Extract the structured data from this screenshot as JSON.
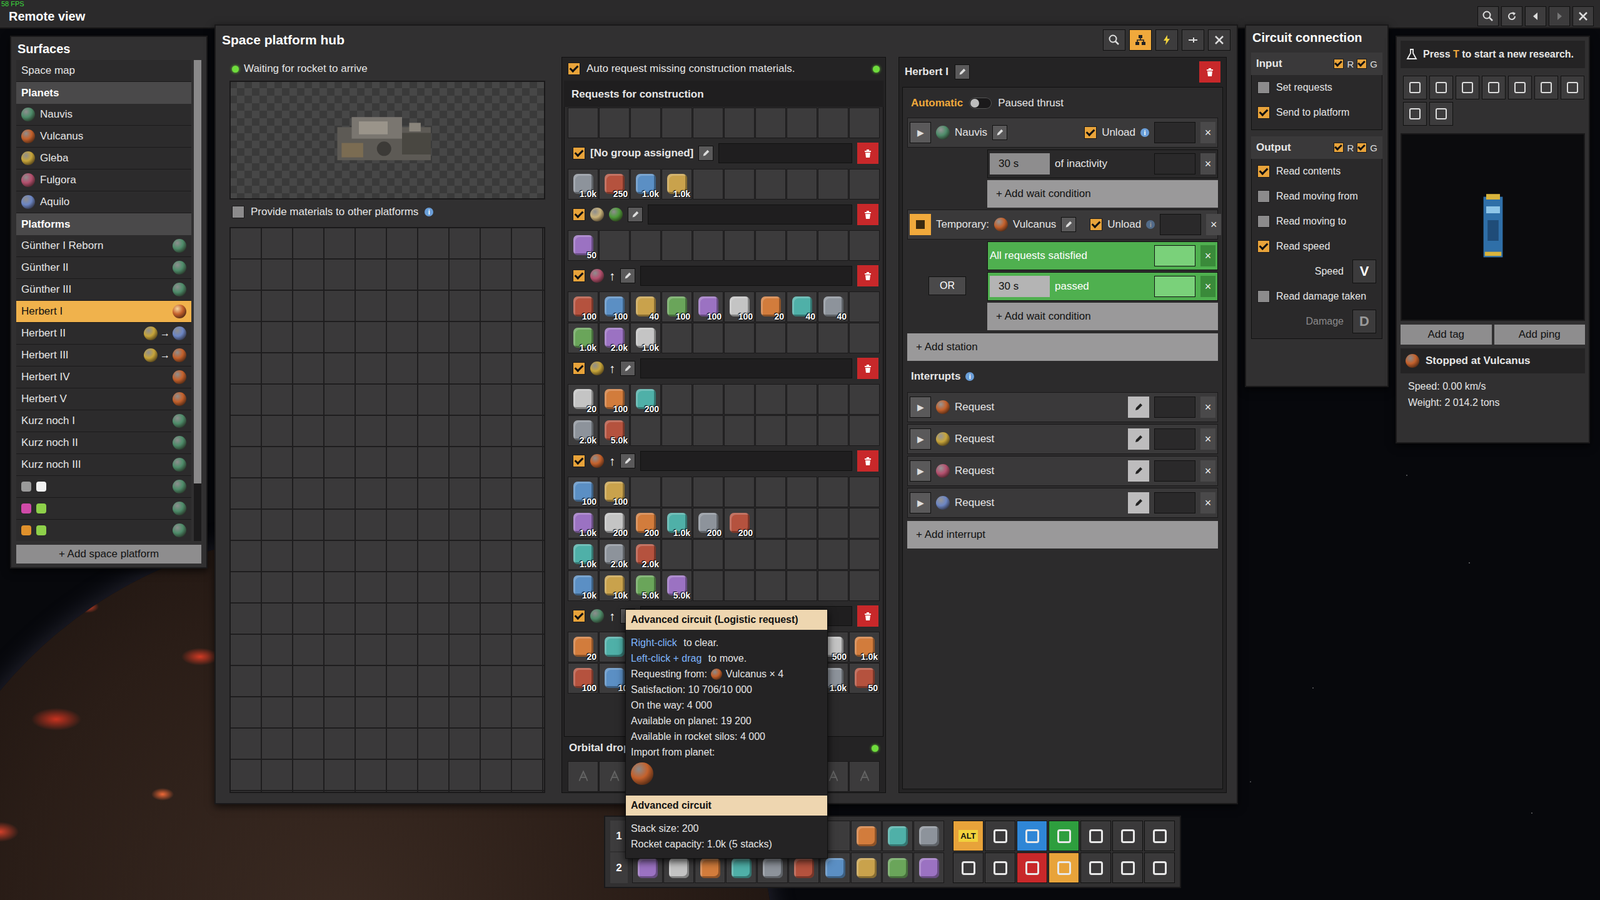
{
  "fps": "58 FPS",
  "window": {
    "title": "Remote view"
  },
  "surfaces": {
    "title": "Surfaces",
    "space_map": "Space map",
    "planets_label": "Planets",
    "planets": [
      {
        "name": "Nauvis",
        "color": "#4e8c6a"
      },
      {
        "name": "Vulcanus",
        "color": "#c4612c"
      },
      {
        "name": "Gleba",
        "color": "#c7a53a"
      },
      {
        "name": "Fulgora",
        "color": "#b4506e"
      },
      {
        "name": "Aquilo",
        "color": "#6c86c4"
      }
    ],
    "platforms_label": "Platforms",
    "platforms": [
      {
        "name": "Günther I Reborn",
        "icons": [],
        "selected": false,
        "from": "#4e8c6a",
        "arrow": "",
        "to": ""
      },
      {
        "name": "Günther II",
        "icons": [],
        "selected": false,
        "from": "#4e8c6a",
        "arrow": "",
        "to": ""
      },
      {
        "name": "Günther III",
        "icons": [],
        "selected": false,
        "from": "#4e8c6a",
        "arrow": "",
        "to": ""
      },
      {
        "name": "Herbert I",
        "icons": [],
        "selected": true,
        "from": "#c4612c",
        "arrow": "",
        "to": ""
      },
      {
        "name": "Herbert II",
        "icons": [],
        "selected": false,
        "from": "#c7a53a",
        "arrow": "→",
        "to": "#6c86c4"
      },
      {
        "name": "Herbert III",
        "icons": [],
        "selected": false,
        "from": "#c7a53a",
        "arrow": "→",
        "to": "#c4612c"
      },
      {
        "name": "Herbert IV",
        "icons": [],
        "selected": false,
        "from": "#c4612c",
        "arrow": "",
        "to": ""
      },
      {
        "name": "Herbert V",
        "icons": [],
        "selected": false,
        "from": "#c4612c",
        "arrow": "",
        "to": ""
      },
      {
        "name": "Kurz noch I",
        "icons": [],
        "selected": false,
        "from": "#4e8c6a",
        "arrow": "",
        "to": ""
      },
      {
        "name": "Kurz noch II",
        "icons": [],
        "selected": false,
        "from": "#4e8c6a",
        "arrow": "",
        "to": ""
      },
      {
        "name": "Kurz noch III",
        "icons": [],
        "selected": false,
        "from": "#4e8c6a",
        "arrow": "",
        "to": ""
      },
      {
        "name": "",
        "icons": [
          "#9a9a9a",
          "#f2f2f2"
        ],
        "selected": false,
        "from": "#4e8c6a",
        "arrow": "",
        "to": ""
      },
      {
        "name": "",
        "icons": [
          "#d04aa8",
          "#8ed04a"
        ],
        "selected": false,
        "from": "#4e8c6a",
        "arrow": "",
        "to": ""
      },
      {
        "name": "",
        "icons": [
          "#e0912c",
          "#8ed04a"
        ],
        "selected": false,
        "from": "#4e8c6a",
        "arrow": "",
        "to": ""
      }
    ],
    "add_button": "+ Add space platform"
  },
  "hub": {
    "title": "Space platform hub",
    "toolbar": [
      {
        "kind": "search",
        "selected": false
      },
      {
        "kind": "logistics",
        "selected": true
      },
      {
        "kind": "power",
        "selected": false
      },
      {
        "kind": "pin",
        "selected": false
      },
      {
        "kind": "close",
        "selected": false
      }
    ],
    "status": "Waiting for rocket to arrive",
    "status_ok": true,
    "provide": {
      "label": "Provide materials to other platforms",
      "checked": false,
      "info": "i"
    },
    "auto_request": {
      "label": "Auto request missing construction materials.",
      "checked": true,
      "ok": true
    },
    "requests_title": "Requests for construction",
    "groups": [
      {
        "label": "[No group assigned]",
        "checked": true,
        "icons": [],
        "arrow": "",
        "rows": [
          [
            {
              "count": "1.0k",
              "empty": false
            },
            {
              "count": "250",
              "empty": false
            },
            {
              "count": "1.0k",
              "empty": false
            },
            {
              "count": "1.0k",
              "empty": false
            }
          ]
        ]
      },
      {
        "label": "",
        "checked": true,
        "icons": [
          "#c9b27a",
          "#4e9a3a"
        ],
        "arrow": "",
        "rows": [
          [
            {
              "count": "50",
              "empty": false
            }
          ]
        ]
      },
      {
        "label": "",
        "checked": true,
        "icons": [
          "#b4506e"
        ],
        "arrow": "↑",
        "rows": [
          [
            {
              "count": "100",
              "empty": false
            },
            {
              "count": "100",
              "empty": false
            },
            {
              "count": "40",
              "empty": false
            },
            {
              "count": "100",
              "empty": false
            },
            {
              "count": "100",
              "empty": false
            },
            {
              "count": "100",
              "empty": false
            },
            {
              "count": "20",
              "empty": false
            },
            {
              "count": "40",
              "empty": false
            },
            {
              "count": "40",
              "empty": false
            }
          ],
          [
            {
              "count": "1.0k",
              "empty": false
            },
            {
              "count": "2.0k",
              "empty": false
            },
            {
              "count": "1.0k",
              "empty": false
            }
          ]
        ]
      },
      {
        "label": "",
        "checked": true,
        "icons": [
          "#c7a53a"
        ],
        "arrow": "↑",
        "rows": [
          [
            {
              "count": "20",
              "empty": false
            },
            {
              "count": "100",
              "empty": false
            },
            {
              "count": "200",
              "empty": false
            }
          ],
          [
            {
              "count": "2.0k",
              "empty": false
            },
            {
              "count": "5.0k",
              "empty": false
            }
          ]
        ]
      },
      {
        "label": "",
        "checked": true,
        "icons": [
          "#c4612c"
        ],
        "arrow": "↑",
        "rows": [
          [
            {
              "count": "100",
              "empty": false
            },
            {
              "count": "100",
              "empty": false
            }
          ],
          [
            {
              "count": "1.0k",
              "empty": false
            },
            {
              "count": "200",
              "empty": false
            },
            {
              "count": "200",
              "empty": false
            },
            {
              "count": "1.0k",
              "empty": false
            },
            {
              "count": "200",
              "empty": false
            },
            {
              "count": "200",
              "empty": false
            }
          ],
          [
            {
              "count": "1.0k",
              "empty": false
            },
            {
              "count": "2.0k",
              "empty": false
            },
            {
              "count": "2.0k",
              "empty": false
            }
          ],
          [
            {
              "count": "10k",
              "empty": false
            },
            {
              "count": "10k",
              "empty": false
            },
            {
              "count": "5.0k",
              "empty": false
            },
            {
              "count": "5.0k",
              "empty": false
            }
          ]
        ]
      },
      {
        "label": "",
        "checked": true,
        "icons": [
          "#4e8c6a"
        ],
        "arrow": "↑",
        "rows": [
          [
            {
              "count": "20",
              "empty": false
            },
            {
              "count": "",
              "empty": false
            },
            {
              "count": "",
              "empty": true
            },
            {
              "count": "",
              "empty": true
            },
            {
              "count": "",
              "empty": true
            },
            {
              "count": "",
              "empty": true
            },
            {
              "count": "",
              "empty": true
            },
            {
              "count": "1.0k",
              "empty": false
            },
            {
              "count": "500",
              "empty": false
            },
            {
              "count": "1.0k",
              "empty": false
            }
          ],
          [
            {
              "count": "100",
              "empty": false
            },
            {
              "count": "10",
              "empty": false
            },
            {
              "count": "",
              "empty": true
            },
            {
              "count": "",
              "empty": true
            },
            {
              "count": "",
              "empty": true
            },
            {
              "count": "",
              "empty": true
            },
            {
              "count": "",
              "empty": true
            },
            {
              "count": "100",
              "empty": false
            },
            {
              "count": "1.0k",
              "empty": false
            },
            {
              "count": "50",
              "empty": false
            }
          ]
        ]
      }
    ],
    "orbital_drop": {
      "label": "Orbital drop",
      "ok": true
    }
  },
  "schedule": {
    "title": "Herbert I",
    "switch": {
      "left": "Automatic",
      "right": "Paused thrust",
      "left_selected": true
    },
    "play": "▶",
    "remove": "×",
    "info": "i",
    "stations": [
      {
        "prefix": "",
        "name": "Nauvis",
        "planet": "#4e8c6a",
        "current": false,
        "unload": {
          "label": "Unload",
          "checked": true
        },
        "connector": "",
        "conditions": [
          {
            "value": "30 s",
            "text": "of inactivity",
            "satisfied": false
          }
        ]
      },
      {
        "prefix": "Temporary:",
        "name": "Vulcanus",
        "planet": "#c4612c",
        "current": true,
        "unload": {
          "label": "Unload",
          "checked": true
        },
        "connector": "OR",
        "conditions": [
          {
            "value": "",
            "text": "All requests satisfied",
            "satisfied": true
          },
          {
            "value": "30 s",
            "text": "passed",
            "satisfied": true
          }
        ]
      }
    ],
    "add_condition": "+ Add wait condition",
    "add_station": "+ Add station",
    "interrupts_label": "Interrupts",
    "interrupts": [
      {
        "name": "Request",
        "planet": "#c4612c"
      },
      {
        "name": "Request",
        "planet": "#c7a53a"
      },
      {
        "name": "Request",
        "planet": "#b4506e"
      },
      {
        "name": "Request",
        "planet": "#6c86c4"
      }
    ],
    "add_interrupt": "+ Add interrupt"
  },
  "circuit": {
    "title": "Circuit connection",
    "sections": [
      {
        "title": "Input",
        "r": "R",
        "g": "G",
        "r_checked": true,
        "g_checked": true,
        "rows": [
          {
            "kind": "check",
            "label": "Set requests",
            "checked": false,
            "value": "",
            "disabled": false
          },
          {
            "kind": "check",
            "label": "Send to platform",
            "checked": true,
            "value": "",
            "disabled": false
          }
        ]
      },
      {
        "title": "Output",
        "r": "R",
        "g": "G",
        "r_checked": true,
        "g_checked": true,
        "rows": [
          {
            "kind": "check",
            "label": "Read contents",
            "checked": true,
            "value": "",
            "disabled": false
          },
          {
            "kind": "check",
            "label": "Read moving from",
            "checked": false,
            "value": "",
            "disabled": false
          },
          {
            "kind": "check",
            "label": "Read moving to",
            "checked": false,
            "value": "",
            "disabled": false
          },
          {
            "kind": "check",
            "label": "Read speed",
            "checked": true,
            "value": "",
            "disabled": false
          },
          {
            "kind": "signal",
            "label": "Speed",
            "checked": false,
            "value": "V",
            "disabled": false
          },
          {
            "kind": "check",
            "label": "Read damage taken",
            "checked": false,
            "value": "",
            "disabled": false
          },
          {
            "kind": "signal",
            "label": "Damage",
            "checked": false,
            "value": "D",
            "disabled": true
          }
        ]
      }
    ]
  },
  "right_panel": {
    "research": {
      "before": "Press ",
      "key": "T",
      "after": " to start a new research."
    },
    "buttons": [
      "Add tag",
      "Add ping"
    ],
    "status": "Stopped at Vulcanus",
    "status_planet": "#c4612c",
    "stats": [
      "Speed: 0.00 km/s",
      "Weight: 2 014.2 tons"
    ]
  },
  "tooltip": {
    "title": "Advanced circuit (Logistic request)",
    "hints": [
      {
        "key": "Right-click",
        "text": " to clear."
      },
      {
        "key": "Left-click + drag",
        "text": " to move."
      }
    ],
    "requesting_label": "Requesting from:",
    "requesting_planet": "#c4612c",
    "requesting_text": "Vulcanus × 4",
    "lines": [
      "Satisfaction: 10 706/10 000",
      "On the way: 4 000",
      "Available on planet: 19 200",
      "Available in rocket silos: 4 000",
      "Import from planet:"
    ],
    "import_planet": "#c4612c",
    "item_title": "Advanced circuit",
    "item_lines": [
      "Stack size: 200",
      "Rocket capacity: 1.0k (5 stacks)"
    ]
  },
  "toolbar": {
    "rows": [
      {
        "label": "1",
        "slots": [
          false,
          false,
          false,
          false,
          false,
          true,
          false,
          true,
          true,
          true
        ]
      },
      {
        "label": "2",
        "slots": [
          true,
          true,
          true,
          true,
          true,
          true,
          true,
          true,
          true,
          true
        ]
      }
    ],
    "shortcuts": [
      [
        {
          "label": "ALT",
          "color": "#e8a33a"
        },
        {
          "label": "",
          "color": "#3a393a"
        },
        {
          "label": "",
          "color": "#2f86d6"
        },
        {
          "label": "",
          "color": "#2e9e3e"
        },
        {
          "label": "",
          "color": "#3a393a"
        },
        {
          "label": "",
          "color": "#3a393a"
        },
        {
          "label": "",
          "color": "#3a393a"
        }
      ],
      [
        {
          "label": "",
          "color": "#3a393a"
        },
        {
          "label": "",
          "color": "#3a393a"
        },
        {
          "label": "",
          "color": "#c8282a"
        },
        {
          "label": "",
          "color": "#e8a33a"
        },
        {
          "label": "",
          "color": "#3a393a"
        },
        {
          "label": "",
          "color": "#3a393a"
        },
        {
          "label": "",
          "color": "#3a393a"
        }
      ]
    ]
  }
}
